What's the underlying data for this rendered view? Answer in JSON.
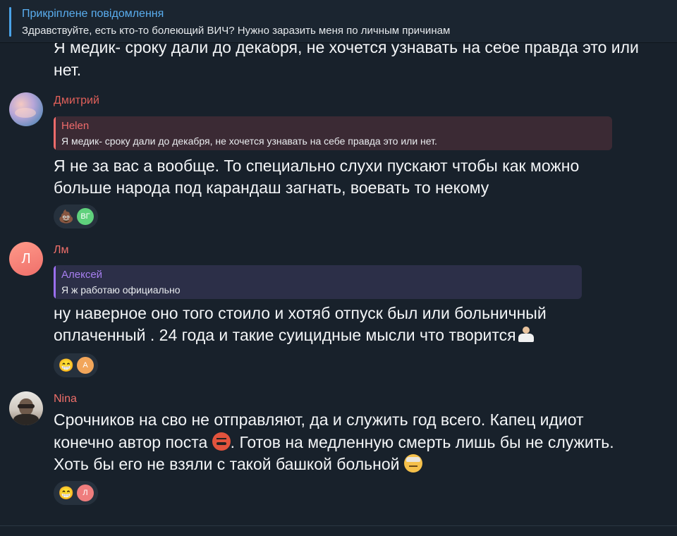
{
  "pinned": {
    "title": "Прикріплене повідомлення",
    "text": "Здравствуйте, есть кто-то болеющий ВИЧ? Нужно заразить меня по личным причинам"
  },
  "partial_message": {
    "lines": [
      "Я медик- сроку дали до декабря, не хочется узнавать на себе правда это или",
      "нет."
    ]
  },
  "messages": [
    {
      "sender": "Дмитрий",
      "sender_color": "#e0605a",
      "reply": {
        "name": "Helen",
        "name_color": "#ef6b6b",
        "bar_color": "#ef6b6b",
        "bg_color": "#3b2a34",
        "text": "Я медик- сроку дали до декабря, не хочется узнавать на себе правда это или нет."
      },
      "lines": [
        "Я не за вас а вообще. То специально слухи пускают чтобы как можно",
        "больше народа под карандаш загнать, воевать то некому"
      ],
      "reactions": {
        "emoji": "💩",
        "user_initials": "ВГ",
        "user_color": "#5fd17c"
      }
    },
    {
      "sender": "Лм",
      "sender_color": "#ef6f6a",
      "avatar_letter": "Л",
      "reply": {
        "name": "Алексей",
        "name_color": "#a77ff0",
        "bar_color": "#9b6ff0",
        "bg_color": "#2c2f48",
        "text": "Я ж работаю официально"
      },
      "lines": [
        "ну наверное оно того стоило  и хотяб отпуск был или больничный",
        "оплаченный . 24 года и такие суицидные мысли что творится"
      ],
      "reactions": {
        "emoji": "😁",
        "user_initials": "А",
        "user_color": "#f2a65a"
      }
    },
    {
      "sender": "Nina",
      "sender_color": "#ef6f6a",
      "lines": [
        "Срочников на сво не отправляют, да и служить год всего. Капец идиот",
        "конечно автор поста",
        ". Готов на медленную смерть лишь бы не служить.",
        "Хоть бы его не взяли с такой башкой больной"
      ],
      "reactions": {
        "emoji": "😁",
        "user_initials": "Л",
        "user_color": "#ef7d7d"
      }
    }
  ],
  "icons": {
    "shrug": "person-shrugging-emoji",
    "angry": "face-with-symbols-on-mouth-emoji",
    "bandage": "face-with-head-bandage-emoji"
  }
}
